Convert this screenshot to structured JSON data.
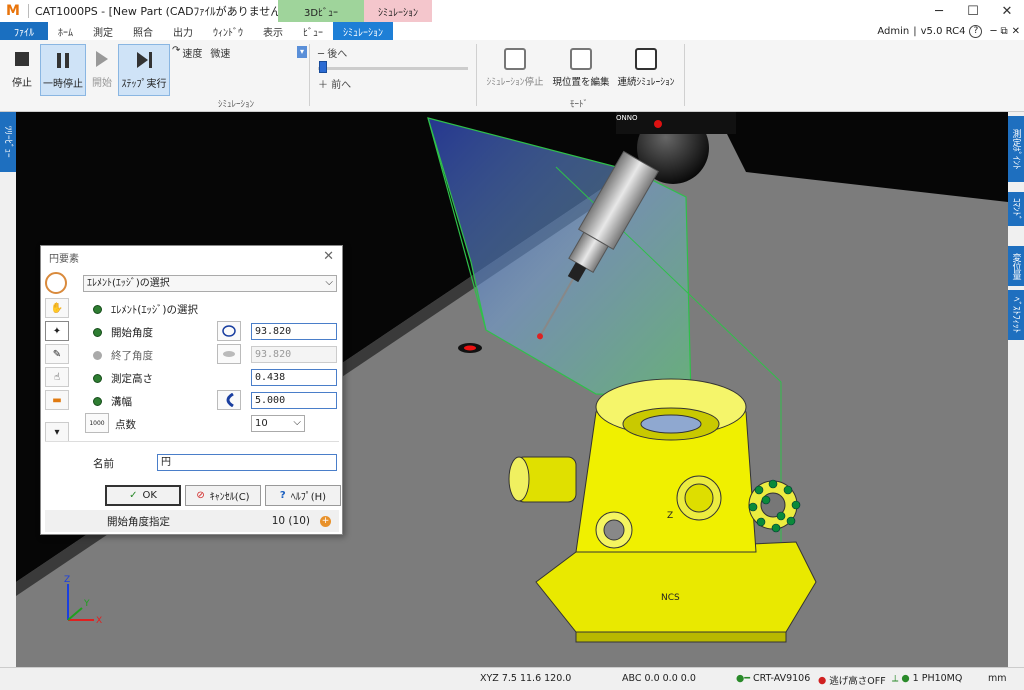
{
  "app": {
    "logo": "M",
    "title": "CAT1000PS - [New Part (CADﾌｧｲﾙがありません)]",
    "context_tab_3d": "3Dﾋﾞｭｰ",
    "context_tab_sim": "ｼﾐｭﾚｰｼｮﾝ",
    "user": "Admin",
    "version": "v5.0 RC4"
  },
  "menu": [
    "ﾌｧｲﾙ",
    "ﾎｰﾑ",
    "測定",
    "照合",
    "出力",
    "ｳｨﾝﾄﾞｳ",
    "表示",
    "ﾋﾞｭｰ",
    "ｼﾐｭﾚｰｼｮﾝ"
  ],
  "ribbon": {
    "stop": "停止",
    "pause": "一時停止",
    "start": "開始",
    "step": "ｽﾃｯﾌﾟ実行",
    "speed_label": "速度",
    "speed_value": "微速",
    "back": "後へ",
    "forward": "前へ",
    "group_sim": "ｼﾐｭﾚｰｼｮﾝ",
    "sim_stop": "ｼﾐｭﾚｰｼｮﾝ停止",
    "edit_pos": "現位置を編集",
    "continuous": "連続ｼﾐｭﾚｰｼｮﾝ",
    "group_mode": "ﾓｰﾄﾞ",
    "slider_position": 0.02
  },
  "side_tabs": {
    "left": "ﾂﾘｰﾋﾞｭｰ",
    "right": [
      "測定ﾎﾟｲﾝﾄ",
      "ｺﾏﾝﾄﾞ",
      "変位量",
      "ﾍﾞｽﾄﾌｨｯﾄ"
    ]
  },
  "viewport": {
    "probe_label": "ONNO",
    "labels": [
      "Z",
      "NCS"
    ],
    "triad": {
      "z": "Z",
      "y": "Y",
      "x": "X"
    }
  },
  "dialog": {
    "title": "円要素",
    "mode_select": "ｴﾚﾒﾝﾄ(ｴｯｼﾞ)の選択",
    "section_label": "ｴﾚﾒﾝﾄ(ｴｯｼﾞ)の選択",
    "start_angle_label": "開始角度",
    "start_angle_value": "93.820",
    "end_angle_label": "終了角度",
    "end_angle_value": "93.820",
    "meas_height_label": "測定高さ",
    "meas_height_value": "0.438",
    "groove_label": "溝幅",
    "groove_value": "5.000",
    "points_label": "点数",
    "points_value": "10",
    "points_icon_text": "1000",
    "name_label": "名前",
    "name_value": "円",
    "ok": "OK",
    "cancel": "ｷｬﾝｾﾙ(C)",
    "help": "ﾍﾙﾌﾟ(H)",
    "status_left": "開始角度指定",
    "status_right": "10 (10)"
  },
  "statusbar": {
    "xyz": "XYZ 7.5 11.6 120.0",
    "abc": "ABC 0.0 0.0 0.0",
    "sensor": "CRT-AV9106",
    "clearance": "逃げ高さOFF",
    "probe": "1 PH10MQ",
    "unit": "mm"
  }
}
